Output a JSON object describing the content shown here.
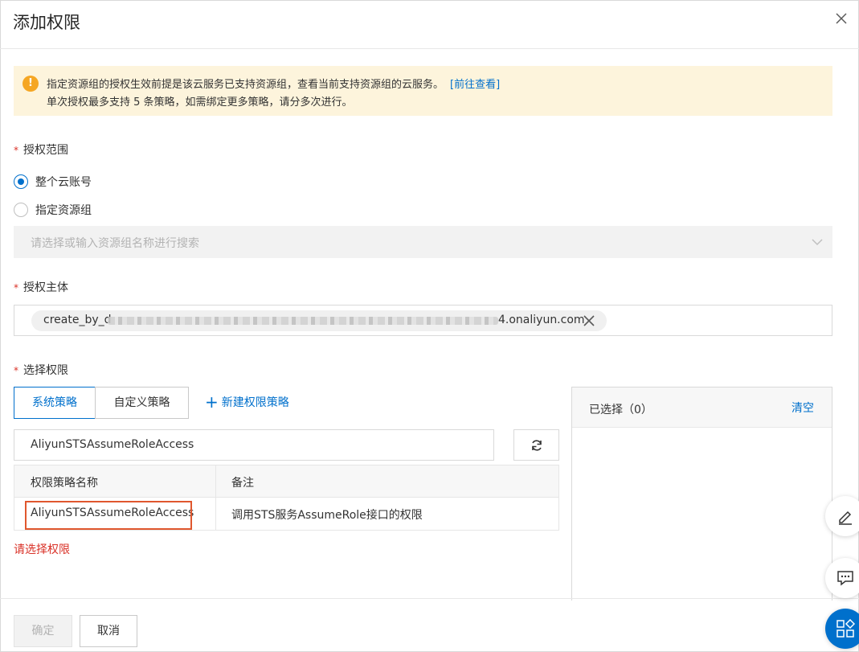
{
  "dialog": {
    "title": "添加权限"
  },
  "alert": {
    "line1": "指定资源组的授权生效前提是该云服务已支持资源组，查看当前支持资源组的云服务。",
    "link": "[前往查看]",
    "line2": "单次授权最多支持 5 条策略，如需绑定更多策略，请分多次进行。"
  },
  "scope": {
    "label": "授权范围",
    "options": [
      {
        "label": "整个云账号",
        "selected": true
      },
      {
        "label": "指定资源组",
        "selected": false
      }
    ],
    "select_placeholder": "请选择或输入资源组名称进行搜索"
  },
  "principal": {
    "label": "授权主体",
    "tag_prefix": "create_by_d",
    "tag_suffix": "4.onaliyun.com"
  },
  "permissions": {
    "label": "选择权限",
    "tabs": [
      {
        "label": "系统策略",
        "active": true
      },
      {
        "label": "自定义策略",
        "active": false
      }
    ],
    "new_policy": "新建权限策略",
    "search_value": "AliyunSTSAssumeRoleAccess",
    "table": {
      "headers": [
        "权限策略名称",
        "备注"
      ],
      "rows": [
        {
          "name": "AliyunSTSAssumeRoleAccess",
          "note": "调用STS服务AssumeRole接口的权限"
        }
      ]
    },
    "error": "请选择权限"
  },
  "selected_panel": {
    "label": "已选择（0）",
    "clear": "清空"
  },
  "footer": {
    "ok": "确定",
    "cancel": "取消"
  },
  "colors": {
    "accent": "#0070cc",
    "error": "#d93026",
    "warning": "#f5a623",
    "alert_bg": "#fdf4dc",
    "highlight": "#e0572e"
  },
  "icons": [
    "close-icon",
    "warning-icon",
    "chevron-down-icon",
    "remove-tag-icon",
    "plus-icon",
    "refresh-icon",
    "edit-icon",
    "chat-icon",
    "apps-icon"
  ]
}
